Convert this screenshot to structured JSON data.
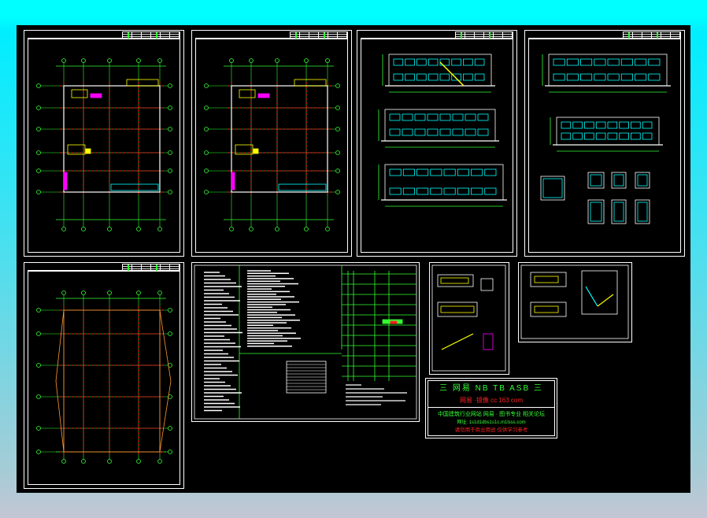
{
  "canvas": {
    "background": "#000000",
    "viewport_background": "#00ffff"
  },
  "colors": {
    "axis": "#33ff33",
    "grid": "#ff2020",
    "wall": "#ffffff",
    "accent_yellow": "#ffff00",
    "accent_magenta": "#ff00ff",
    "accent_cyan": "#00ffff"
  },
  "sheets": [
    {
      "id": "floor-plan-1",
      "type": "plan"
    },
    {
      "id": "floor-plan-2",
      "type": "plan"
    },
    {
      "id": "elevations-1",
      "type": "elevation"
    },
    {
      "id": "elevations-2",
      "type": "elevation"
    },
    {
      "id": "roof-plan",
      "type": "roof"
    },
    {
      "id": "design-notes",
      "type": "notes"
    },
    {
      "id": "stair-detail-1",
      "type": "detail"
    },
    {
      "id": "stair-detail-2",
      "type": "detail"
    }
  ],
  "note_box": {
    "line1": "三 网易 NB TB ASB 三",
    "line2": "网易 ·镜像   cc 163 com",
    "line3": "中国建筑行业网站 网易 · 图书专业 相关论坛",
    "line4": "网址: 1s1d1dbs1s1c.m1lsss.com",
    "line5": "请勿用于商业用途 仅供学习参考"
  }
}
